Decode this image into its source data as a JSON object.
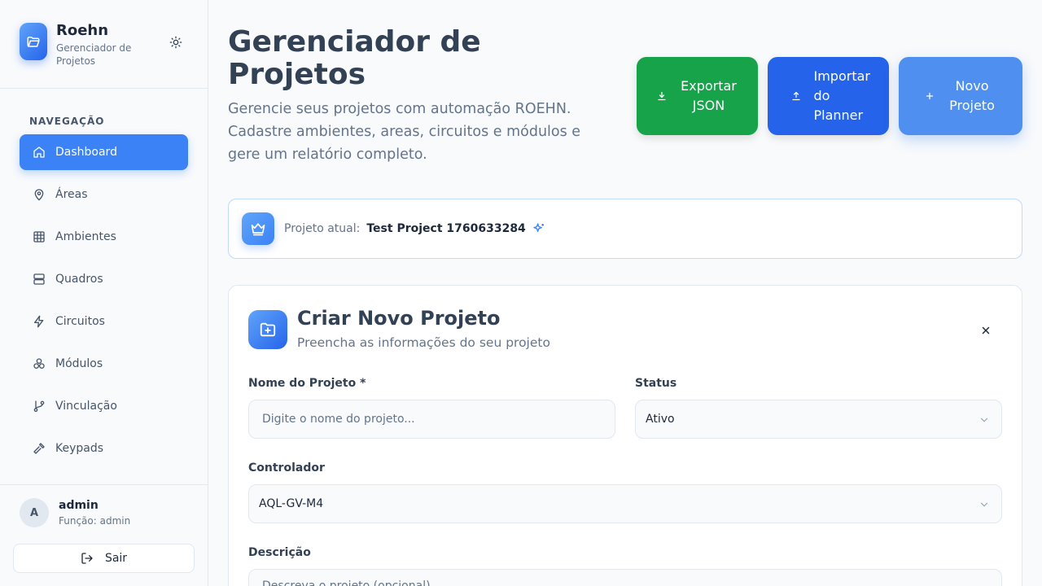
{
  "brand": {
    "name": "Roehn",
    "subtitle": "Gerenciador de Projetos"
  },
  "sidebar": {
    "nav_title": "NAVEGAÇÃO",
    "items": [
      {
        "label": "Dashboard",
        "icon": "home-icon",
        "active": true
      },
      {
        "label": "Áreas",
        "icon": "map-pin-icon"
      },
      {
        "label": "Ambientes",
        "icon": "grid-icon"
      },
      {
        "label": "Quadros",
        "icon": "server-icon"
      },
      {
        "label": "Circuitos",
        "icon": "zap-icon"
      },
      {
        "label": "Módulos",
        "icon": "boxes-icon"
      },
      {
        "label": "Vinculação",
        "icon": "git-branch-icon"
      },
      {
        "label": "Keypads",
        "icon": "hammer-icon"
      }
    ],
    "user": {
      "initial": "A",
      "name": "admin",
      "role": "Função: admin"
    },
    "logout_label": "Sair"
  },
  "header": {
    "title": "Gerenciador de Projetos",
    "description": "Gerencie seus projetos com automação ROEHN. Cadastre ambientes, areas, circuitos e módulos e gere um relatório completo.",
    "buttons": {
      "export": "Exportar JSON",
      "import": "Importar do Planner",
      "new": "Novo Projeto"
    }
  },
  "current_project": {
    "label": "Projeto atual:",
    "name": "Test Project 1760633284"
  },
  "form": {
    "title": "Criar Novo Projeto",
    "subtitle": "Preencha as informações do seu projeto",
    "name_label": "Nome do Projeto *",
    "name_placeholder": "Digite o nome do projeto...",
    "status_label": "Status",
    "status_value": "Ativo",
    "controller_label": "Controlador",
    "controller_value": "AQL-GV-M4",
    "description_label": "Descrição",
    "description_placeholder": "Descreva o projeto (opcional)"
  },
  "colors": {
    "primary": "#3b82f6",
    "export": "#16a34a",
    "import": "#2563eb",
    "new": "#4f8ff0"
  }
}
